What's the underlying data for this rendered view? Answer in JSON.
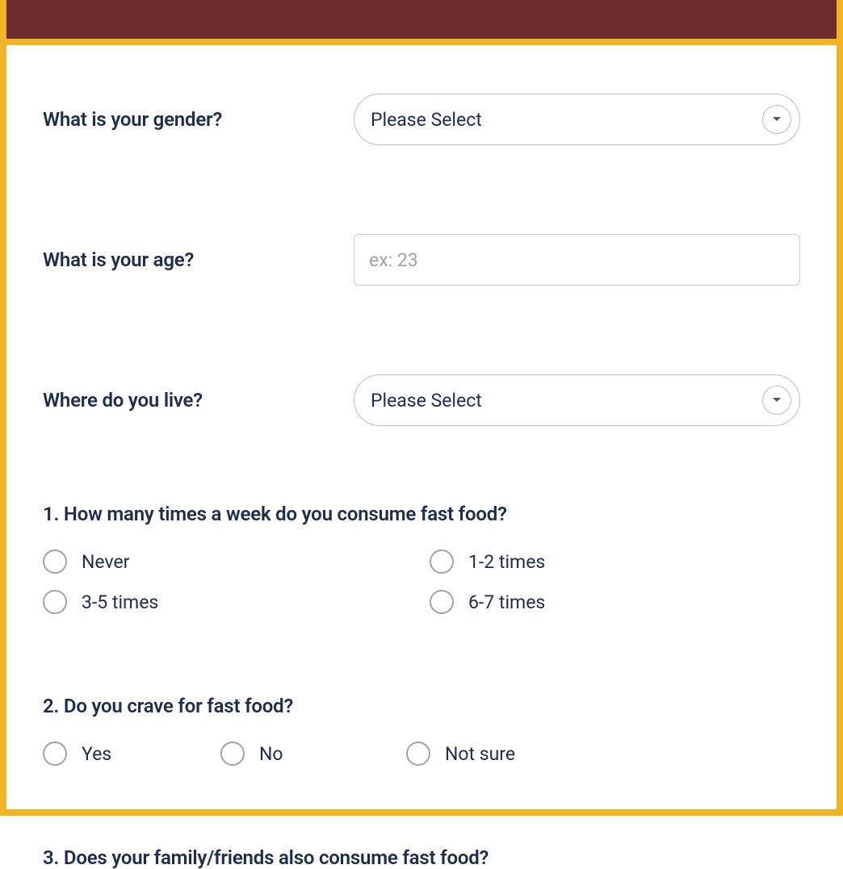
{
  "fields": {
    "gender": {
      "label": "What is your gender?",
      "placeholder": "Please Select"
    },
    "age": {
      "label": "What is your age?",
      "placeholder": "ex: 23"
    },
    "location": {
      "label": "Where do you live?",
      "placeholder": "Please Select"
    }
  },
  "questions": {
    "q1": {
      "title": "1. How many times a week do you consume fast food?",
      "options": [
        "Never",
        "1-2 times",
        "3-5 times",
        "6-7 times"
      ]
    },
    "q2": {
      "title": "2. Do you crave for fast food?",
      "options": [
        "Yes",
        "No",
        "Not sure"
      ]
    },
    "q3": {
      "title": "3. Does your family/friends also consume fast food?"
    }
  }
}
